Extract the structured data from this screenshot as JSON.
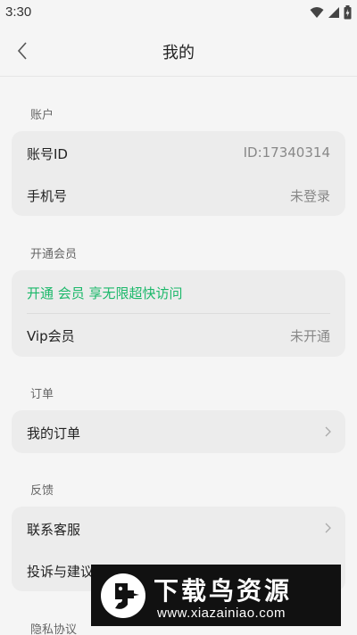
{
  "status_bar": {
    "time": "3:30"
  },
  "nav": {
    "title": "我的"
  },
  "sections": {
    "account": {
      "label": "账户",
      "rows": [
        {
          "label": "账号ID",
          "value": "ID:17340314"
        },
        {
          "label": "手机号",
          "value": "未登录"
        }
      ]
    },
    "vip": {
      "label": "开通会员",
      "promo": "开通 会员 享无限超快访问",
      "rows": [
        {
          "label": "Vip会员",
          "value": "未开通"
        }
      ]
    },
    "orders": {
      "label": "订单",
      "rows": [
        {
          "label": "我的订单"
        }
      ]
    },
    "feedback": {
      "label": "反馈",
      "rows": [
        {
          "label": "联系客服"
        },
        {
          "label": "投诉与建议"
        }
      ]
    },
    "privacy": {
      "label": "隐私协议"
    }
  },
  "watermark": {
    "title": "下载鸟资源",
    "url": "www.xiazainiao.com"
  },
  "colors": {
    "accent": "#1bb86a",
    "background": "#f5f5f5",
    "card": "#ececec"
  }
}
